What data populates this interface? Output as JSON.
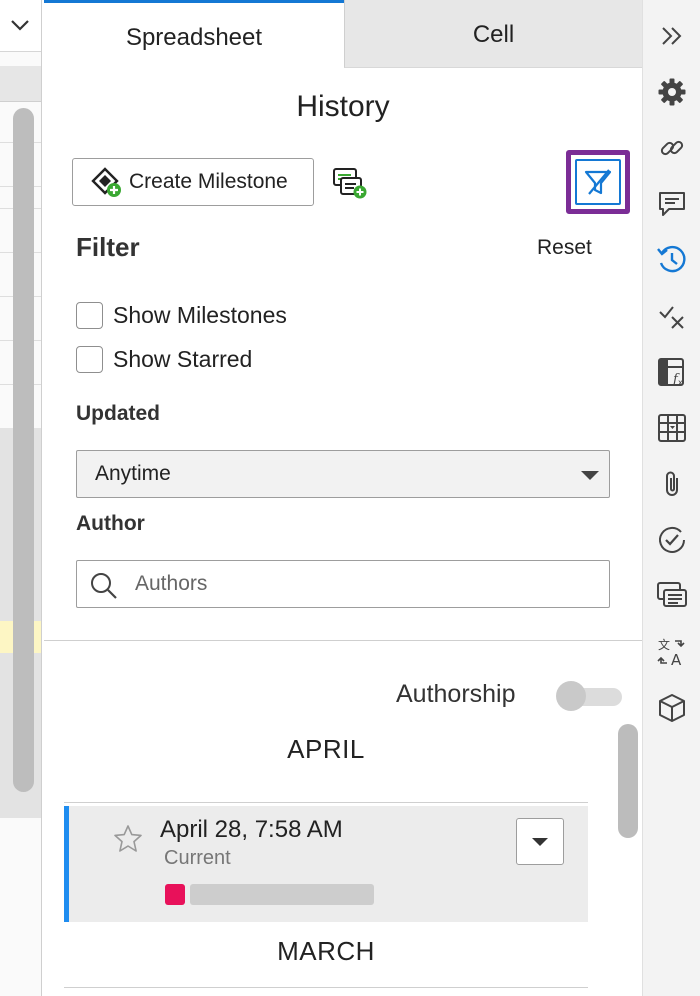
{
  "tabs": [
    {
      "label": "Spreadsheet",
      "active": true
    },
    {
      "label": "Cell",
      "active": false
    }
  ],
  "history": {
    "title": "History",
    "create_milestone_label": "Create Milestone",
    "filter_heading": "Filter",
    "reset_label": "Reset",
    "show_milestones_label": "Show Milestones",
    "show_starred_label": "Show Starred",
    "updated_label": "Updated",
    "updated_value": "Anytime",
    "author_label": "Author",
    "authors_placeholder": "Authors",
    "authorship_label": "Authorship",
    "authorship_on": false
  },
  "timeline": {
    "months": [
      "APRIL",
      "MARCH"
    ],
    "entries": [
      {
        "date": "April 28, 7:58 AM",
        "status": "Current",
        "author_color": "#e8115a"
      }
    ]
  },
  "rail_icons": [
    "collapse-panel-icon",
    "settings-icon",
    "link-icon",
    "comments-icon",
    "history-icon",
    "accessibility-check-icon",
    "function-icon",
    "table-icon",
    "attachment-icon",
    "approval-icon",
    "forms-icon",
    "translate-icon",
    "3d-model-icon"
  ],
  "colors": {
    "accent": "#1478d4",
    "focus_ring": "#7b2d96",
    "active_entry_border": "#1f8df0",
    "author_swatch": "#e8115a"
  }
}
